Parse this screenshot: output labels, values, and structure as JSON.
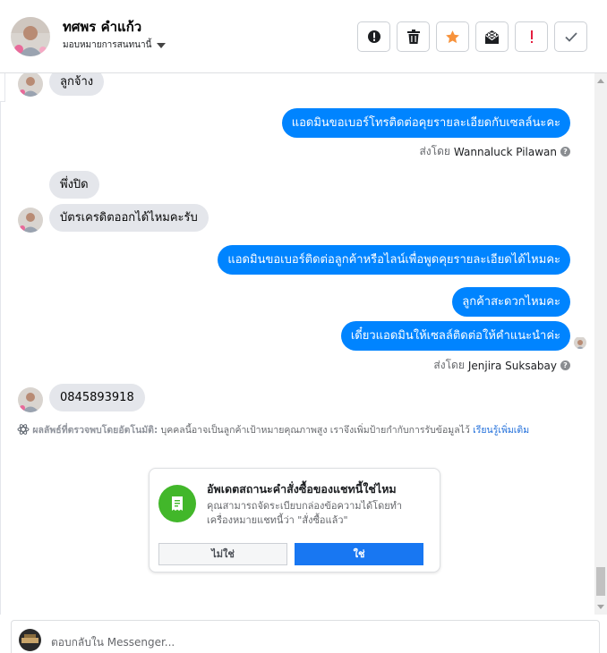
{
  "header": {
    "name": "ทศพร คำแก้ว",
    "assign_label": "มอบหมายการสนทนานี้",
    "actions": [
      {
        "icon": "exclamation-circle-icon",
        "color": "#1c1e21"
      },
      {
        "icon": "trash-icon",
        "color": "#1c1e21"
      },
      {
        "icon": "star-icon",
        "color": "#f7923b"
      },
      {
        "icon": "spam-envelope-icon",
        "color": "#1c1e21"
      },
      {
        "icon": "exclamation-mark-icon",
        "color": "#e41e3f"
      },
      {
        "icon": "check-icon",
        "color": "#606770"
      }
    ]
  },
  "messages": {
    "m1": "ลูกจ้าง",
    "m2": "แอดมินขอเบอร์โทรติดต่อคุยรายละเอียดกับเซลล์นะคะ",
    "sent1_prefix": "ส่งโดย",
    "sent1_name": "Wannaluck Pilawan",
    "m3": "พึ่งปิด",
    "m4": "บัตรเครดิตออกได้ไหมคะรับ",
    "m5": "แอดมินขอเบอร์ติดต่อลูกค้าหรือไลน์เพื่อพูดคุยรายละเอียดได้ไหมคะ",
    "m6": "ลูกค้าสะดวกไหมคะ",
    "m7": "เดี๋ยวแอดมินให้เซลล์ติดต่อให้คำแนะนำค่ะ",
    "sent2_prefix": "ส่งโดย",
    "sent2_name": "Jenjira Suksabay",
    "m8": "0845893918"
  },
  "auto_detect": {
    "label": "ผลลัพธ์ที่ตรวจพบโดยอัตโนมัติ:",
    "text": "บุคคลนี้อาจเป็นลูกค้าเป้าหมายคุณภาพสูง เราจึงเพิ่มป้ายกำกับการรับข้อมูลไว้",
    "link": "เรียนรู้เพิ่มเติม"
  },
  "order_card": {
    "title": "อัพเดตสถานะคำสั่งซื้อของแชทนี้ใช่ไหม",
    "description": "คุณสามารถจัดระเบียบกล่องข้อความได้โดยทำเครื่องหมายแชทนี้ว่า \"สั่งซื้อแล้ว\"",
    "no_label": "ไม่ใช่",
    "yes_label": "ใช่"
  },
  "composer": {
    "placeholder": "ตอบกลับใน Messenger..."
  },
  "colors": {
    "outgoing_bubble": "#0084ff",
    "incoming_bubble": "#e4e6eb",
    "primary_button": "#1877f2",
    "card_icon": "#42b72a"
  }
}
